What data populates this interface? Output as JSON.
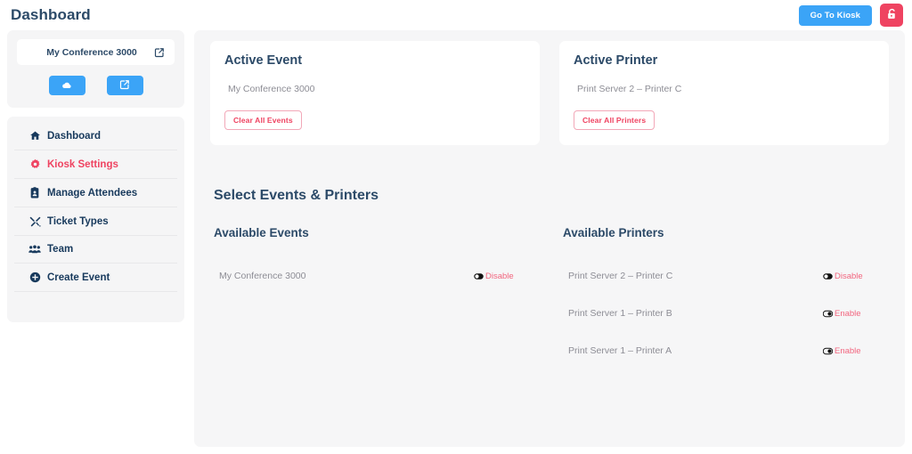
{
  "header": {
    "title": "Dashboard",
    "kiosk_button_label": "Go To Kiosk",
    "lock_icon": "unlock-icon",
    "kiosk_button_color": "#3ba4f7",
    "lock_button_color": "#ef4361"
  },
  "sidebar": {
    "event_card": {
      "event_name": "My Conference 3000",
      "edit_icon": "edit-square-icon",
      "buttons": [
        {
          "icon": "cloud-icon",
          "name": "cloud-sync-button"
        },
        {
          "icon": "edit-square-icon",
          "name": "edit-event-button"
        }
      ]
    },
    "nav_items": [
      {
        "label": "Dashboard",
        "icon": "home-icon",
        "active": false
      },
      {
        "label": "Kiosk Settings",
        "icon": "gear-icon",
        "active": true
      },
      {
        "label": "Manage Attendees",
        "icon": "id-badge-icon",
        "active": false
      },
      {
        "label": "Ticket Types",
        "icon": "tools-icon",
        "active": false
      },
      {
        "label": "Team",
        "icon": "users-icon",
        "active": false
      },
      {
        "label": "Create Event",
        "icon": "plus-circle-icon",
        "active": false
      }
    ]
  },
  "main": {
    "active_event_card": {
      "title": "Active Event",
      "value": "My Conference 3000",
      "clear_button_label": "Clear All Events"
    },
    "active_printer_card": {
      "title": "Active Printer",
      "value": "Print Server 2 – Printer C",
      "clear_button_label": "Clear All Printers"
    },
    "section_title": "Select Events & Printers",
    "available_events": {
      "heading": "Available Events",
      "rows": [
        {
          "label": "My Conference 3000",
          "action": "Disable",
          "toggle_state": "on"
        }
      ]
    },
    "available_printers": {
      "heading": "Available Printers",
      "rows": [
        {
          "label": "Print Server 2 – Printer C",
          "action": "Disable",
          "toggle_state": "on"
        },
        {
          "label": "Print Server 1 – Printer B",
          "action": "Enable",
          "toggle_state": "off"
        },
        {
          "label": "Print Server 1 – Printer A",
          "action": "Enable",
          "toggle_state": "off"
        }
      ]
    }
  },
  "colors": {
    "accent_blue": "#3ba4f7",
    "accent_pink": "#ef4361",
    "heading_blue": "#2c4a68",
    "panel_grey": "#f6f6f7"
  }
}
